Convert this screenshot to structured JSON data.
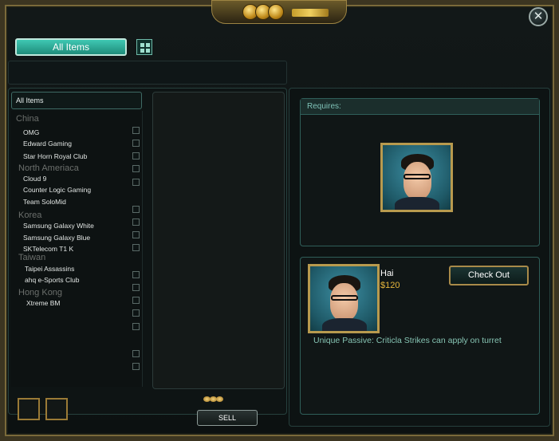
{
  "window": {
    "close_icon": "close-icon"
  },
  "tabs": {
    "all_items_label": "All Items",
    "grid_icon": "grid-icon"
  },
  "category_list": {
    "header": "All Items",
    "entries": [
      {
        "kind": "region",
        "label": "China"
      },
      {
        "kind": "team",
        "label": "OMG"
      },
      {
        "kind": "team",
        "label": "Edward Gaming"
      },
      {
        "kind": "team",
        "label": "Star Horn Royal Club"
      },
      {
        "kind": "region",
        "label": "North Ameriaca"
      },
      {
        "kind": "team",
        "label": "Cloud 9"
      },
      {
        "kind": "team",
        "label": "Counter Logic Gaming"
      },
      {
        "kind": "team",
        "label": "Team SoloMid"
      },
      {
        "kind": "region",
        "label": "Korea"
      },
      {
        "kind": "team",
        "label": "Samsung Galaxy White"
      },
      {
        "kind": "team",
        "label": "Samsung Galaxy Blue"
      },
      {
        "kind": "team",
        "label": "SKTelecom T1 K"
      },
      {
        "kind": "region",
        "label": "Taiwan"
      },
      {
        "kind": "team",
        "label": "Taipei Assassins"
      },
      {
        "kind": "team",
        "label": "ahq e-Sports  Club"
      },
      {
        "kind": "region",
        "label": "Hong Kong"
      },
      {
        "kind": "team",
        "label": "Xtreme BM"
      }
    ]
  },
  "footer": {
    "sell_label": "SELL",
    "coin_icon": "coins-icon"
  },
  "requires": {
    "header": "Requires:"
  },
  "selected_item": {
    "name": "Hai",
    "price": "$120",
    "checkout_label": "Check Out",
    "description": "Unique Passive: Criticla Strikes can apply on turret"
  },
  "colors": {
    "accent": "#3fc8b3",
    "gold": "#e6b63c",
    "description": "#86c4b3"
  }
}
